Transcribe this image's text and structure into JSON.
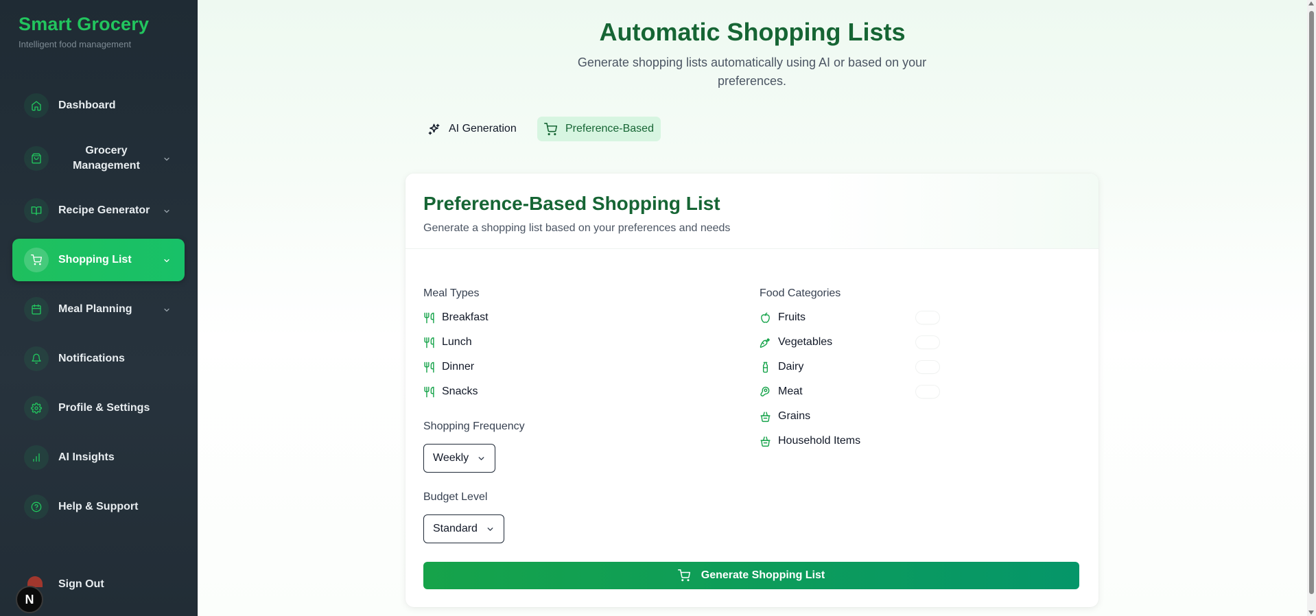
{
  "brand": {
    "title": "Smart Grocery",
    "subtitle": "Intelligent food management",
    "accent_color": "#22c55e"
  },
  "sidebar": {
    "items": [
      {
        "label": "Dashboard",
        "icon": "home-icon",
        "has_chevron": false,
        "active": false
      },
      {
        "label": "Grocery Management",
        "icon": "shopping-bag-icon",
        "has_chevron": true,
        "active": false
      },
      {
        "label": "Recipe Generator",
        "icon": "book-open-icon",
        "has_chevron": true,
        "active": false
      },
      {
        "label": "Shopping List",
        "icon": "cart-icon",
        "has_chevron": true,
        "active": true
      },
      {
        "label": "Meal Planning",
        "icon": "calendar-icon",
        "has_chevron": true,
        "active": false
      },
      {
        "label": "Notifications",
        "icon": "bell-icon",
        "has_chevron": false,
        "active": false
      },
      {
        "label": "Profile & Settings",
        "icon": "gear-icon",
        "has_chevron": false,
        "active": false
      },
      {
        "label": "AI Insights",
        "icon": "bar-chart-icon",
        "has_chevron": false,
        "active": false
      },
      {
        "label": "Help & Support",
        "icon": "help-circle-icon",
        "has_chevron": false,
        "active": false
      }
    ],
    "sign_out": "Sign Out",
    "avatar_letter": "N"
  },
  "header": {
    "title": "Automatic Shopping Lists",
    "subtitle": "Generate shopping lists automatically using AI or based on your preferences."
  },
  "tabs": [
    {
      "label": "AI Generation",
      "icon": "sparkles-icon",
      "active": false
    },
    {
      "label": "Preference-Based",
      "icon": "cart-icon",
      "active": true
    }
  ],
  "card": {
    "title": "Preference-Based Shopping List",
    "description": "Generate a shopping list based on your preferences and needs",
    "meal_types_label": "Meal Types",
    "meal_types": [
      {
        "label": "Breakfast",
        "icon": "utensils-icon",
        "enabled": false
      },
      {
        "label": "Lunch",
        "icon": "utensils-icon",
        "enabled": false
      },
      {
        "label": "Dinner",
        "icon": "utensils-icon",
        "enabled": false
      },
      {
        "label": "Snacks",
        "icon": "utensils-icon",
        "enabled": false
      }
    ],
    "food_categories_label": "Food Categories",
    "food_categories": [
      {
        "label": "Fruits",
        "icon": "apple-icon",
        "enabled": false
      },
      {
        "label": "Vegetables",
        "icon": "carrot-icon",
        "enabled": false
      },
      {
        "label": "Dairy",
        "icon": "milk-icon",
        "enabled": false
      },
      {
        "label": "Meat",
        "icon": "beef-icon",
        "enabled": false
      },
      {
        "label": "Grains",
        "icon": "basket-icon",
        "enabled": false
      },
      {
        "label": "Household Items",
        "icon": "basket-icon",
        "enabled": false
      }
    ],
    "frequency_label": "Shopping Frequency",
    "frequency_value": "Weekly",
    "budget_label": "Budget Level",
    "budget_value": "Standard",
    "generate_label": "Generate Shopping List"
  }
}
